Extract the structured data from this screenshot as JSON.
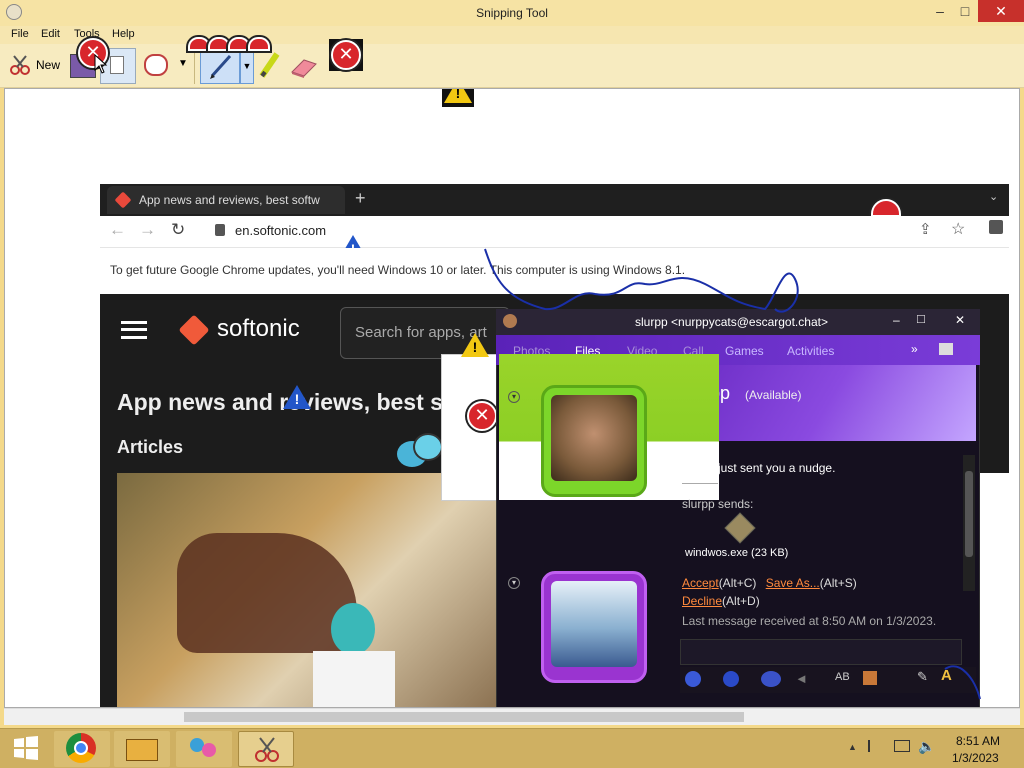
{
  "window": {
    "title": "Snipping Tool"
  },
  "menu": [
    "File",
    "Edit",
    "Tools",
    "Help"
  ],
  "toolbar": {
    "new_label": "New"
  },
  "browser": {
    "tab_title": "App news and reviews, best softw",
    "url": "en.softonic.com",
    "update_notice": "To get future Google Chrome updates, you'll need Windows 10 or later. This computer is using Windows 8.1."
  },
  "softonic": {
    "logo": "softonic",
    "search_placeholder": "Search for apps, art",
    "headline": "App news and reviews, best sof",
    "section": "Articles"
  },
  "chat": {
    "title": "slurpp <nurppycats@escargot.chat>",
    "tabs": [
      "Photos",
      "Files",
      "Video",
      "Call",
      "Games",
      "Activities"
    ],
    "contact_name": "slurpp",
    "contact_status": "(Available)",
    "nudge": "slurpp just sent you a nudge.",
    "sends_label": "slurpp sends:",
    "file_name": "windwos.exe (23 KB)",
    "accept": "Accept",
    "accept_key": "(Alt+C)",
    "save_as": "Save As...",
    "save_key": "(Alt+S)",
    "decline": "Decline",
    "decline_key": "(Alt+D)",
    "last_message": "Last message received at 8:50 AM on 1/3/2023."
  },
  "clock": {
    "time": "8:51 AM",
    "date": "1/3/2023"
  },
  "colors": {
    "taskbar": "#cfb062",
    "title_bar": "#f6e3a4",
    "close": "#c7302b",
    "chat_purple": "#6a2bc4",
    "chat_green": "#8ccf25"
  }
}
